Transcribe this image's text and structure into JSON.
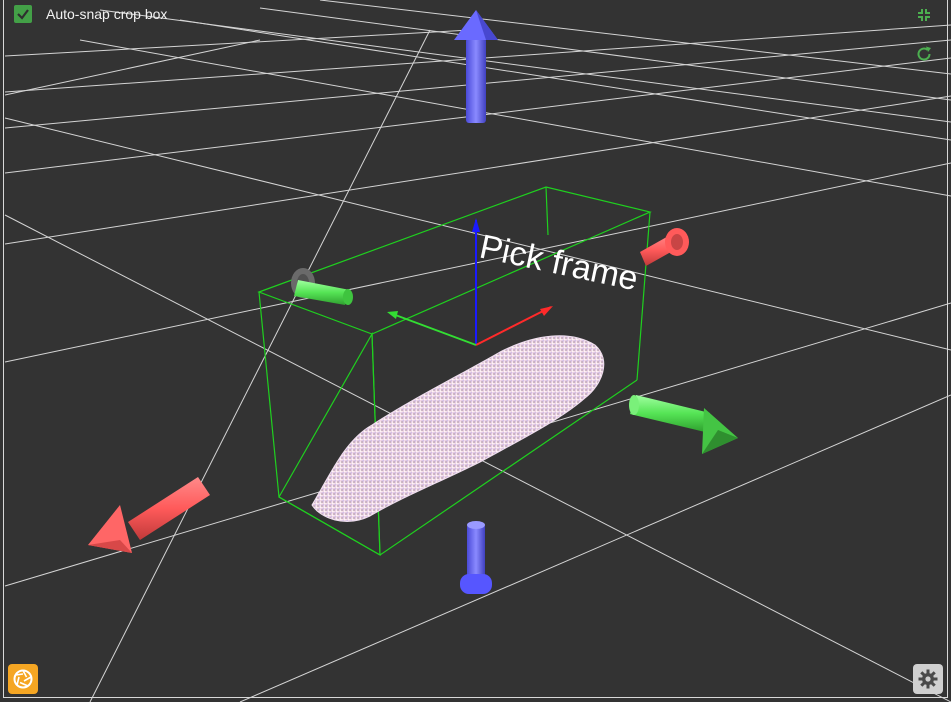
{
  "toolbar": {
    "auto_snap_label": "Auto-snap crop box",
    "auto_snap_checked": true
  },
  "scene": {
    "frame_label": "Pick frame"
  },
  "icons": {
    "checkbox": "check-icon",
    "top_right_1": "collapse-icon",
    "top_right_2": "refresh-icon",
    "bottom_left": "aperture-icon",
    "bottom_right": "gear-icon"
  },
  "colors": {
    "background": "#333333",
    "grid": "#e6e6e6",
    "crop_box": "#1fd01f",
    "accent_green": "#4caf50",
    "handle_blue": "#6464ff",
    "handle_red": "#ff5a5a",
    "handle_green": "#55e455",
    "snapshot_button": "#f5a623",
    "settings_button": "#d0d0d0"
  }
}
